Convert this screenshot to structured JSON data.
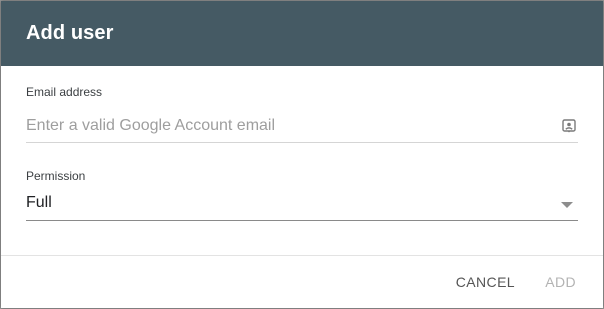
{
  "dialog": {
    "title": "Add user",
    "email": {
      "label": "Email address",
      "value": "",
      "placeholder": "Enter a valid Google Account email",
      "icon": "contact-card-icon"
    },
    "permission": {
      "label": "Permission",
      "selected": "Full",
      "icon": "dropdown-arrow-icon"
    },
    "actions": {
      "cancel_label": "CANCEL",
      "add_label": "ADD"
    }
  },
  "colors": {
    "header_bg": "#455a64",
    "header_text": "#ffffff",
    "disabled_button": "#b3b3b3"
  }
}
